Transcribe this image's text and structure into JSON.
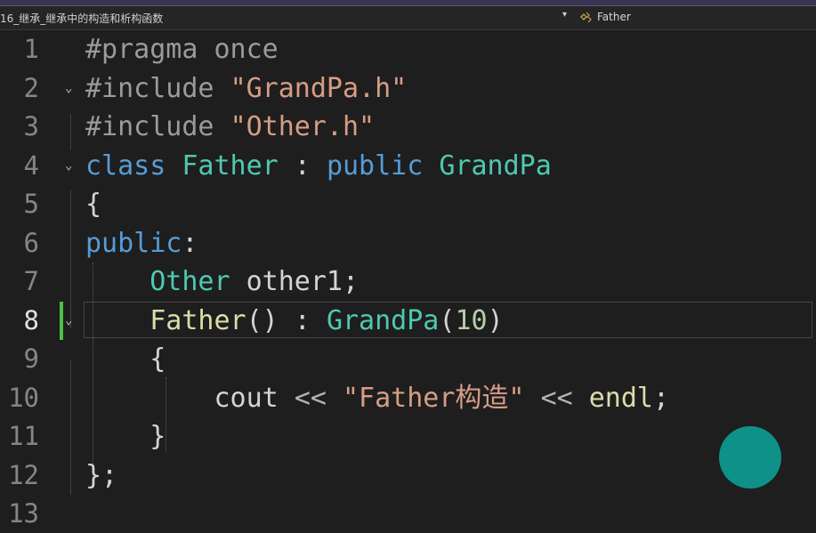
{
  "navbar": {
    "project": "16_继承_继承中的构造和析构函数",
    "scope_dropdown_glyph": "▾",
    "class_icon": "class-icon",
    "class_name": "Father"
  },
  "editor": {
    "active_line": 8,
    "lines": [
      {
        "n": "1",
        "tokens": [
          [
            "pp",
            "#pragma once"
          ]
        ]
      },
      {
        "n": "2",
        "tokens": [
          [
            "pp",
            "#include "
          ],
          [
            "st",
            "\"GrandPa.h\""
          ]
        ]
      },
      {
        "n": "3",
        "tokens": [
          [
            "pp",
            "#include "
          ],
          [
            "st",
            "\"Other.h\""
          ]
        ]
      },
      {
        "n": "4",
        "tokens": [
          [
            "kw",
            "class "
          ],
          [
            "ty",
            "Father"
          ],
          [
            "pl",
            " : "
          ],
          [
            "kw",
            "public "
          ],
          [
            "ty",
            "GrandPa"
          ]
        ]
      },
      {
        "n": "5",
        "tokens": [
          [
            "pl",
            "{"
          ]
        ]
      },
      {
        "n": "6",
        "tokens": [
          [
            "kw",
            "public"
          ],
          [
            "pl",
            ":"
          ]
        ]
      },
      {
        "n": "7",
        "tokens": [
          [
            "pl",
            "    "
          ],
          [
            "ty",
            "Other"
          ],
          [
            "pl",
            " other1;"
          ]
        ]
      },
      {
        "n": "8",
        "tokens": [
          [
            "pl",
            "    "
          ],
          [
            "fn",
            "Father"
          ],
          [
            "pl",
            "() : "
          ],
          [
            "ty",
            "GrandPa"
          ],
          [
            "pl",
            "("
          ],
          [
            "nu",
            "10"
          ],
          [
            "pl",
            ")"
          ]
        ]
      },
      {
        "n": "9",
        "tokens": [
          [
            "pl",
            "    {"
          ]
        ]
      },
      {
        "n": "10",
        "tokens": [
          [
            "pl",
            "        cout "
          ],
          [
            "op",
            "<<"
          ],
          [
            "pl",
            " "
          ],
          [
            "st",
            "\"Father构造\""
          ],
          [
            "pl",
            " "
          ],
          [
            "op",
            "<<"
          ],
          [
            "pl",
            " "
          ],
          [
            "fn",
            "endl"
          ],
          [
            "pl",
            ";"
          ]
        ]
      },
      {
        "n": "11",
        "tokens": [
          [
            "pl",
            "    }"
          ]
        ]
      },
      {
        "n": "12",
        "tokens": [
          [
            "pl",
            "};"
          ]
        ]
      },
      {
        "n": "13",
        "tokens": []
      }
    ],
    "fold_markers": [
      {
        "line": 2,
        "glyph": "⌄"
      },
      {
        "line": 4,
        "glyph": "⌄"
      },
      {
        "line": 8,
        "glyph": "⌄"
      }
    ]
  },
  "colors": {
    "keyword": "#569cd6",
    "type": "#4ec9b0",
    "function": "#dcdcaa",
    "string": "#d69d85",
    "number": "#b5cea8",
    "change_bar": "#4ec045",
    "overlay_circle": "#0e9189"
  }
}
